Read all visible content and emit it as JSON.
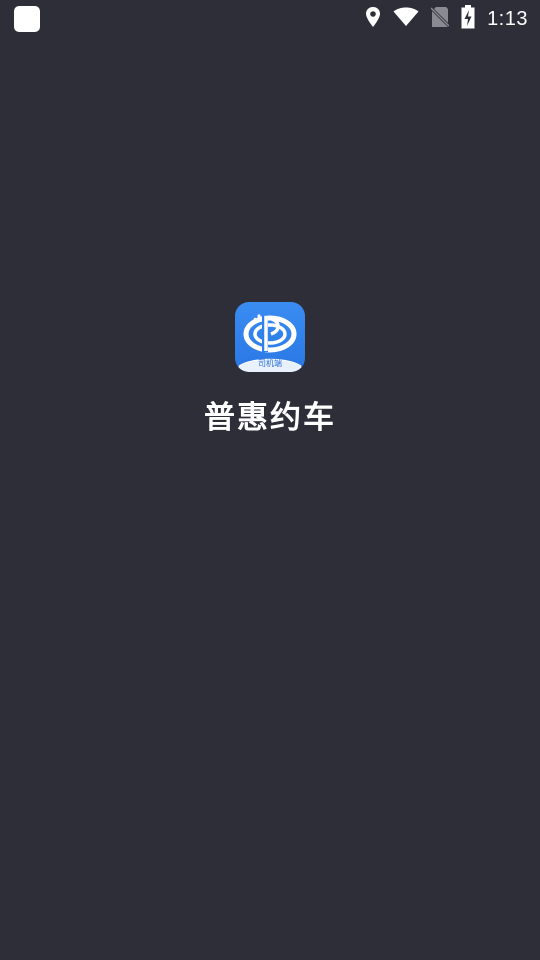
{
  "status_bar": {
    "time": "1:13",
    "icons": [
      "notification-icon",
      "location-icon",
      "wifi-icon",
      "no-sim-icon",
      "battery-charging-icon"
    ]
  },
  "splash": {
    "app_name": "普惠约车",
    "icon_caption": "司机端",
    "icon_name": "app-logo-icon"
  },
  "colors": {
    "background": "#2e2e38",
    "icon_blue": "#2f7fec",
    "text": "#ffffff"
  }
}
